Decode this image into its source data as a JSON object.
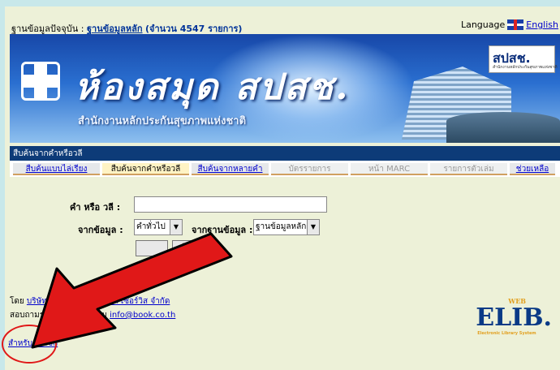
{
  "header": {
    "current_db_prefix": "ฐานข้อมูลปัจจุบัน : ",
    "current_db_name": "ฐานข้อมูลหลัก",
    "record_count": "(จำนวน 4547 รายการ)",
    "language_label": "Language",
    "language_link": "English"
  },
  "banner": {
    "title": "ห้องสมุด สปสช.",
    "subtitle": "สำนักงานหลักประกันสุขภาพแห่งชาติ",
    "logo_text": "สปสช.",
    "logo_subtext": "สำนักงานหลักประกันสุขภาพแห่งชาติ"
  },
  "nav": {
    "section_title": "สืบค้นจากคำหรือวลี",
    "tabs": [
      {
        "label": "สืบค้นแบบไล่เรียง",
        "state": "link"
      },
      {
        "label": "สืบค้นจากคำหรือวลี",
        "state": "active"
      },
      {
        "label": "สืบค้นจากหลายคำ",
        "state": "link"
      },
      {
        "label": "บัตรรายการ",
        "state": "disabled"
      },
      {
        "label": "หน้า MARC",
        "state": "disabled"
      },
      {
        "label": "รายการตัวเล่ม",
        "state": "disabled"
      },
      {
        "label": "ช่วยเหลือ",
        "state": "link"
      }
    ]
  },
  "search_form": {
    "phrase_label": "คำ หรือ วลี :",
    "phrase_value": "",
    "from_field_label": "จากข้อมูล :",
    "from_field_value": "คำทั่วไป",
    "from_db_label": "จากฐานข้อมูล :",
    "from_db_value": "ฐานข้อมูลหลัก",
    "clear_button": "ล้างช่อง"
  },
  "footer": {
    "by_prefix": "โดย ",
    "company_link": "บริษัท บุ๊คโปรโมชั่น แอนด์ เซอร์วิส จำกัด",
    "contact_prefix": "สอบถามรายละเอียดเพิ่มเติม ",
    "email_link": "info@book.co.th",
    "member_link": "สำหรับสมาชิก"
  },
  "elib_logo": {
    "text": "ELIB.",
    "web": "WEB",
    "tag": "Electronic Library System"
  },
  "colors": {
    "accent_arrow": "#e01818",
    "nav_bar": "#0d3b78",
    "link": "#0000cc"
  }
}
